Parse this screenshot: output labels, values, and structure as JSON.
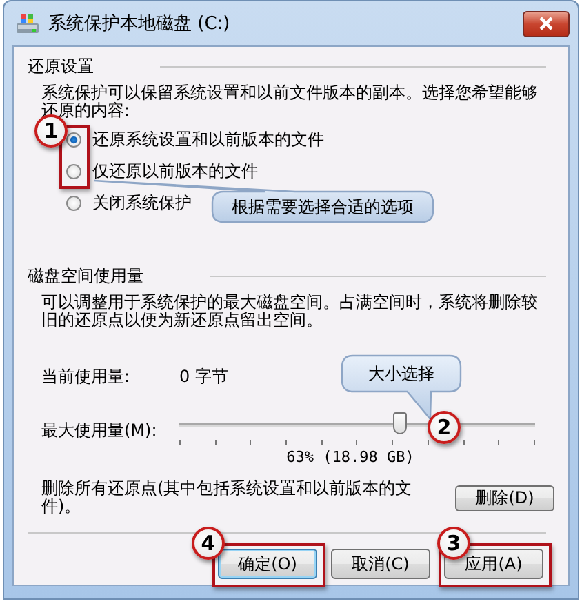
{
  "window": {
    "title": "系统保护本地磁盘 (C:)"
  },
  "restore_settings": {
    "heading": "还原设置",
    "description": "系统保护可以保留系统设置和以前文件版本的副本。选择您希望能够还原的内容:",
    "options": [
      {
        "label": "还原系统设置和以前版本的文件",
        "selected": true
      },
      {
        "label": "仅还原以前版本的文件",
        "selected": false
      },
      {
        "label": "关闭系统保护",
        "selected": false
      }
    ]
  },
  "disk_usage": {
    "heading": "磁盘空间使用量",
    "description": "可以调整用于系统保护的最大磁盘空间。占满空间时，系统将删除较旧的还原点以便为新还原点留出空间。",
    "current_label": "当前使用量:",
    "current_value": "0 字节",
    "max_label": "最大使用量(M):",
    "slider": {
      "level": 0.62
    },
    "reading": "63% (18.98 GB)",
    "delete_text": "删除所有还原点(其中包括系统设置和以前版本的文件)。",
    "delete_button": "删除(D)"
  },
  "buttons": [
    {
      "label": "确定(O)",
      "default": true
    },
    {
      "label": "取消(C)",
      "default": false
    },
    {
      "label": "应用(A)",
      "default": false
    }
  ],
  "annotations": {
    "badges": [
      "1",
      "2",
      "3",
      "4"
    ],
    "callouts": [
      "根据需要选择合适的选项",
      "大小选择"
    ]
  }
}
